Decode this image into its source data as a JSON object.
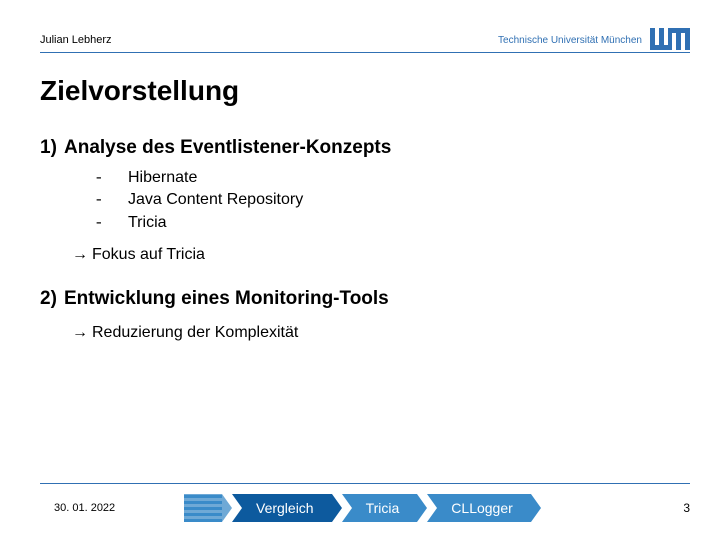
{
  "header": {
    "author": "Julian Lebherz",
    "university": "Technische Universität München"
  },
  "title": "Zielvorstellung",
  "section1": {
    "number": "1)",
    "heading": "Analyse des Eventlistener-Konzepts",
    "items": [
      "Hibernate",
      "Java Content Repository",
      "Tricia"
    ],
    "arrow": "Fokus auf Tricia"
  },
  "section2": {
    "number": "2)",
    "heading": "Entwicklung eines Monitoring-Tools",
    "arrow": "Reduzierung der Komplexität"
  },
  "footer": {
    "date": "30. 01. 2022",
    "tabs": [
      "Vergleich",
      "Tricia",
      "CLLogger"
    ],
    "page": "3"
  },
  "colors": {
    "tum_blue": "#3070b3",
    "chev_light": "#3a8bc9",
    "chev_dark": "#0d5a9e"
  }
}
